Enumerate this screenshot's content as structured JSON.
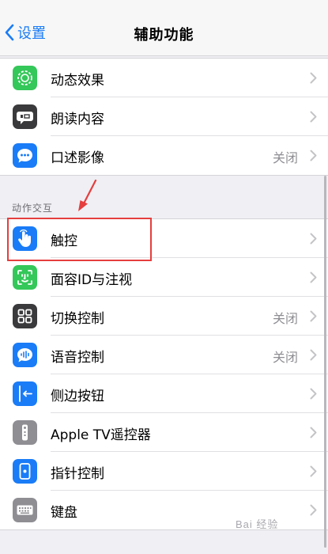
{
  "nav": {
    "back_label": "设置",
    "title": "辅助功能"
  },
  "top_group": [
    {
      "label": "动态效果",
      "value": "",
      "icon": "motion-icon",
      "color": "#34c759"
    },
    {
      "label": "朗读内容",
      "value": "",
      "icon": "speech-bubble-icon",
      "color": "#3a3a3c"
    },
    {
      "label": "口述影像",
      "value": "关闭",
      "icon": "audio-description-icon",
      "color": "#1a7cf7"
    }
  ],
  "section": {
    "header": "动作交互",
    "items": [
      {
        "label": "触控",
        "value": "",
        "icon": "touch-hand-icon",
        "color": "#1a7cf7"
      },
      {
        "label": "面容ID与注视",
        "value": "",
        "icon": "face-id-icon",
        "color": "#34c759"
      },
      {
        "label": "切换控制",
        "value": "关闭",
        "icon": "switch-control-icon",
        "color": "#3a3a3c"
      },
      {
        "label": "语音控制",
        "value": "关闭",
        "icon": "voice-control-icon",
        "color": "#1a7cf7"
      },
      {
        "label": "侧边按钮",
        "value": "",
        "icon": "side-button-icon",
        "color": "#1a7cf7"
      },
      {
        "label": "Apple TV遥控器",
        "value": "",
        "icon": "remote-icon",
        "color": "#8e8e93"
      },
      {
        "label": "指针控制",
        "value": "",
        "icon": "pointer-control-icon",
        "color": "#1a7cf7"
      },
      {
        "label": "键盘",
        "value": "",
        "icon": "keyboard-icon",
        "color": "#8e8e93"
      }
    ]
  },
  "watermark": "Bai 经验"
}
